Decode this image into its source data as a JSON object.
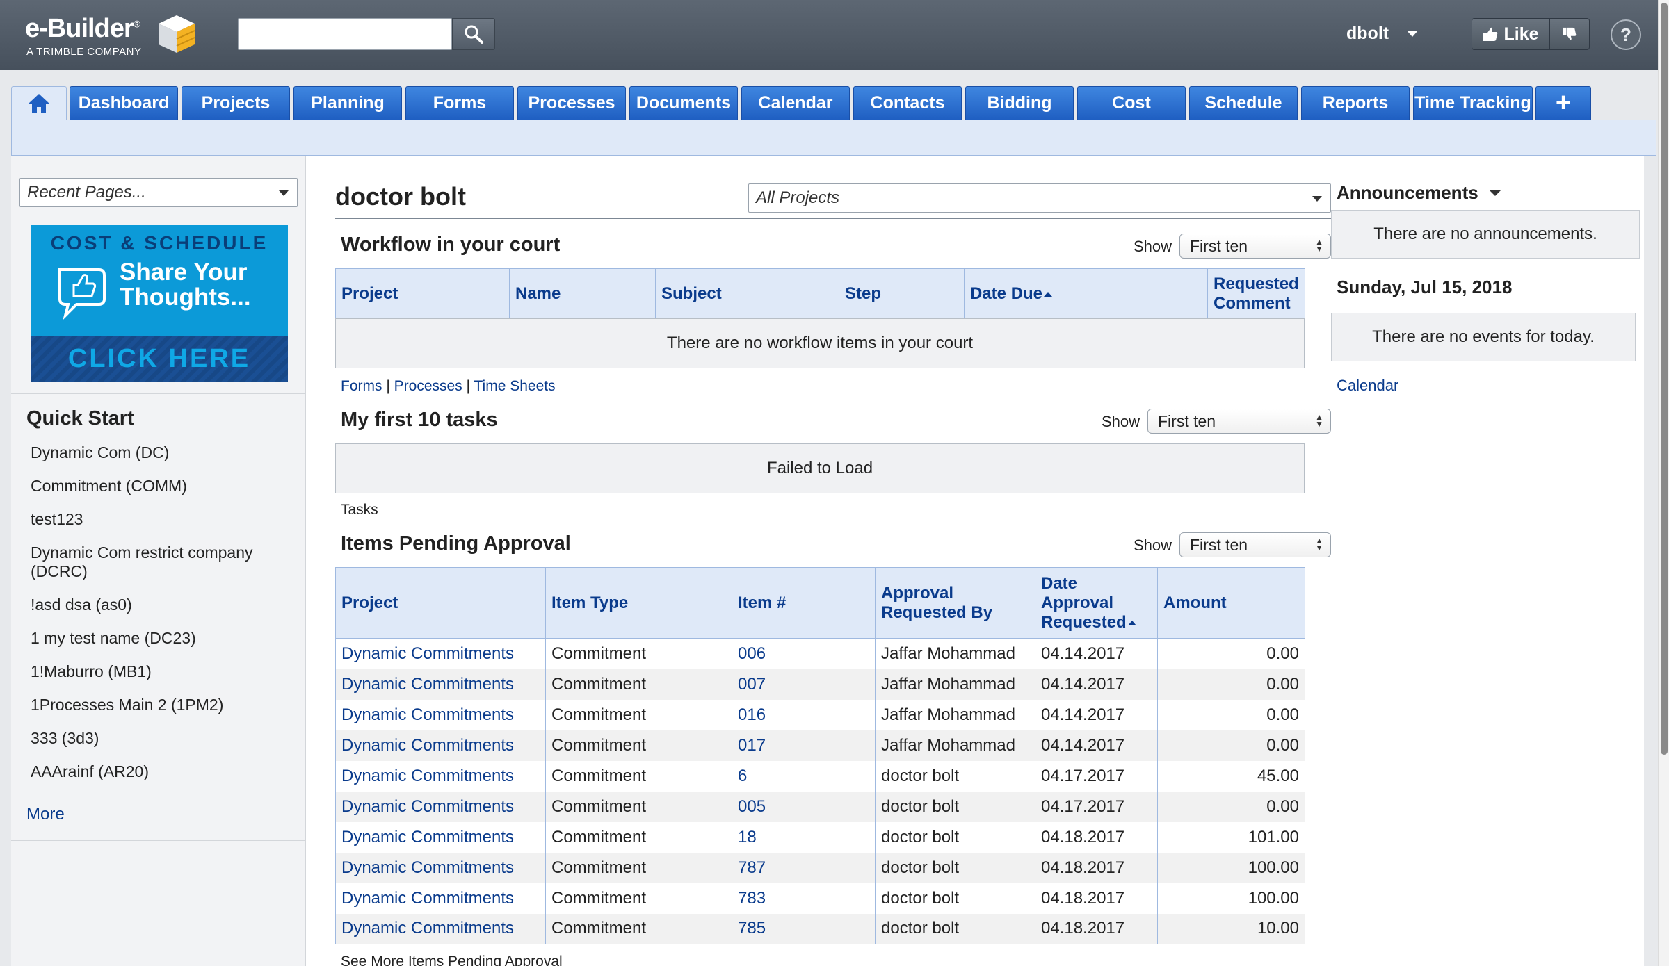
{
  "header": {
    "logo_main": "e-Builder",
    "logo_reg": "®",
    "logo_sub": "A TRIMBLE COMPANY",
    "search_value": "",
    "user": "dbolt",
    "like_label": "Like",
    "help_label": "?"
  },
  "nav": {
    "tabs": [
      "Dashboard",
      "Projects",
      "Planning",
      "Forms",
      "Processes",
      "Documents",
      "Calendar",
      "Contacts",
      "Bidding",
      "Cost",
      "Schedule",
      "Reports",
      "Time Tracking"
    ],
    "add_label": "+",
    "active_color": "#1f5fc2"
  },
  "sidebar": {
    "recent_pages": "Recent Pages...",
    "banner": {
      "line1": "COST & SCHEDULE",
      "line2": "Share Your",
      "line3": "Thoughts...",
      "cta": "CLICK HERE"
    },
    "quick_start_title": "Quick Start",
    "quick_start": [
      "Dynamic Com (DC)",
      "Commitment (COMM)",
      "test123",
      "Dynamic Com restrict company (DCRC)",
      "!asd dsa (as0)",
      "1 my test name (DC23)",
      "1!Maburro (MB1)",
      "1Processes Main 2 (1PM2)",
      "333 (3d3)",
      "AAArainf (AR20)"
    ],
    "more_label": "More"
  },
  "main": {
    "user_title": "doctor bolt",
    "project_filter": "All Projects",
    "workflow": {
      "title": "Workflow in your court",
      "show_label": "Show",
      "show_value": "First ten",
      "columns": [
        "Project",
        "Name",
        "Subject",
        "Step",
        "Date Due",
        "Requested Comment"
      ],
      "empty": "There are no workflow items in your court",
      "links": [
        "Forms",
        "Processes",
        "Time Sheets"
      ],
      "sep": "|"
    },
    "tasks": {
      "title": "My first 10 tasks",
      "show_label": "Show",
      "show_value": "First ten",
      "status": "Failed to Load",
      "link": "Tasks"
    },
    "pending": {
      "title": "Items Pending Approval",
      "show_label": "Show",
      "show_value": "First ten",
      "columns": [
        "Project",
        "Item Type",
        "Item #",
        "Approval Requested By",
        "Date Approval Requested",
        "Amount"
      ],
      "rows": [
        [
          "Dynamic Commitments",
          "Commitment",
          "006",
          "Jaffar Mohammad",
          "04.14.2017",
          "0.00"
        ],
        [
          "Dynamic Commitments",
          "Commitment",
          "007",
          "Jaffar Mohammad",
          "04.14.2017",
          "0.00"
        ],
        [
          "Dynamic Commitments",
          "Commitment",
          "016",
          "Jaffar Mohammad",
          "04.14.2017",
          "0.00"
        ],
        [
          "Dynamic Commitments",
          "Commitment",
          "017",
          "Jaffar Mohammad",
          "04.14.2017",
          "0.00"
        ],
        [
          "Dynamic Commitments",
          "Commitment",
          "6",
          "doctor bolt",
          "04.17.2017",
          "45.00"
        ],
        [
          "Dynamic Commitments",
          "Commitment",
          "005",
          "doctor bolt",
          "04.17.2017",
          "0.00"
        ],
        [
          "Dynamic Commitments",
          "Commitment",
          "18",
          "doctor bolt",
          "04.18.2017",
          "101.00"
        ],
        [
          "Dynamic Commitments",
          "Commitment",
          "787",
          "doctor bolt",
          "04.18.2017",
          "100.00"
        ],
        [
          "Dynamic Commitments",
          "Commitment",
          "783",
          "doctor bolt",
          "04.18.2017",
          "100.00"
        ],
        [
          "Dynamic Commitments",
          "Commitment",
          "785",
          "doctor bolt",
          "04.18.2017",
          "10.00"
        ]
      ],
      "see_more": "See More Items Pending Approval"
    }
  },
  "right": {
    "announcements_title": "Announcements",
    "announcements_empty": "There are no announcements.",
    "date": "Sunday, Jul 15, 2018",
    "events_empty": "There are no events for today.",
    "calendar_link": "Calendar"
  }
}
